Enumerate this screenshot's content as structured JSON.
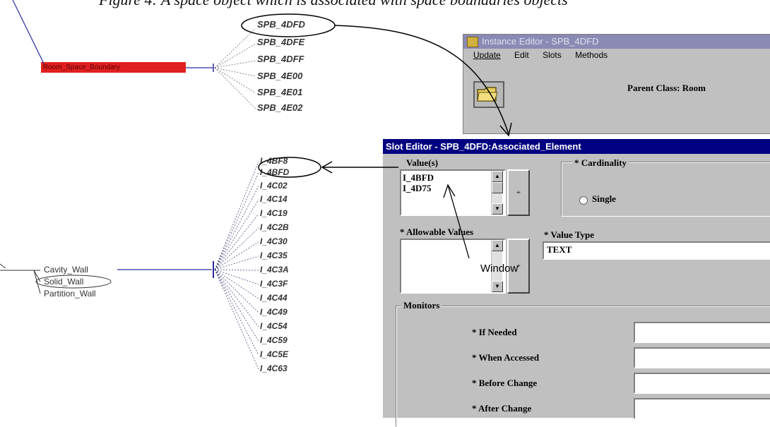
{
  "caption": "Figure 4: A space object which is associated with space boundaries objects",
  "space_boundary_node": "Room_Space_Boundary",
  "spb_items": [
    "SPB_4DFD",
    "SPB_4DFE",
    "SPB_4DFF",
    "SPB_4E00",
    "SPB_4E01",
    "SPB_4E02"
  ],
  "i_items": [
    "I_4BF8",
    "I_4BFD",
    "I_4C02",
    "I_4C14",
    "I_4C19",
    "I_4C2B",
    "I_4C30",
    "I_4C35",
    "I_4C3A",
    "I_4C3F",
    "I_4C44",
    "I_4C49",
    "I_4C54",
    "I_4C59",
    "I_4C5E",
    "I_4C63"
  ],
  "wall_items": [
    "Cavity_Wall",
    "Solid_Wall",
    "Partition_Wall"
  ],
  "instance_editor": {
    "title": "Instance Editor - SPB_4DFD",
    "menu": [
      "Update",
      "Edit",
      "Slots",
      "Methods"
    ],
    "parent_class_label": "Parent Class:  Room"
  },
  "slot_editor": {
    "title": "Slot Editor - SPB_4DFD:Associated_Element",
    "values_label": "Value(s)",
    "values": [
      "I_4BFD",
      "I_4D75"
    ],
    "cardinality_label": "* Cardinality",
    "single_label": "Single",
    "allowable_label": "* Allowable Values",
    "value_type_label": "* Value Type",
    "value_type": "TEXT",
    "monitors_label": "Monitors",
    "monitors": [
      "* If Needed",
      "* When Accessed",
      "* Before Change",
      "* After Change"
    ],
    "add_button": "+"
  },
  "annotation": "Window"
}
